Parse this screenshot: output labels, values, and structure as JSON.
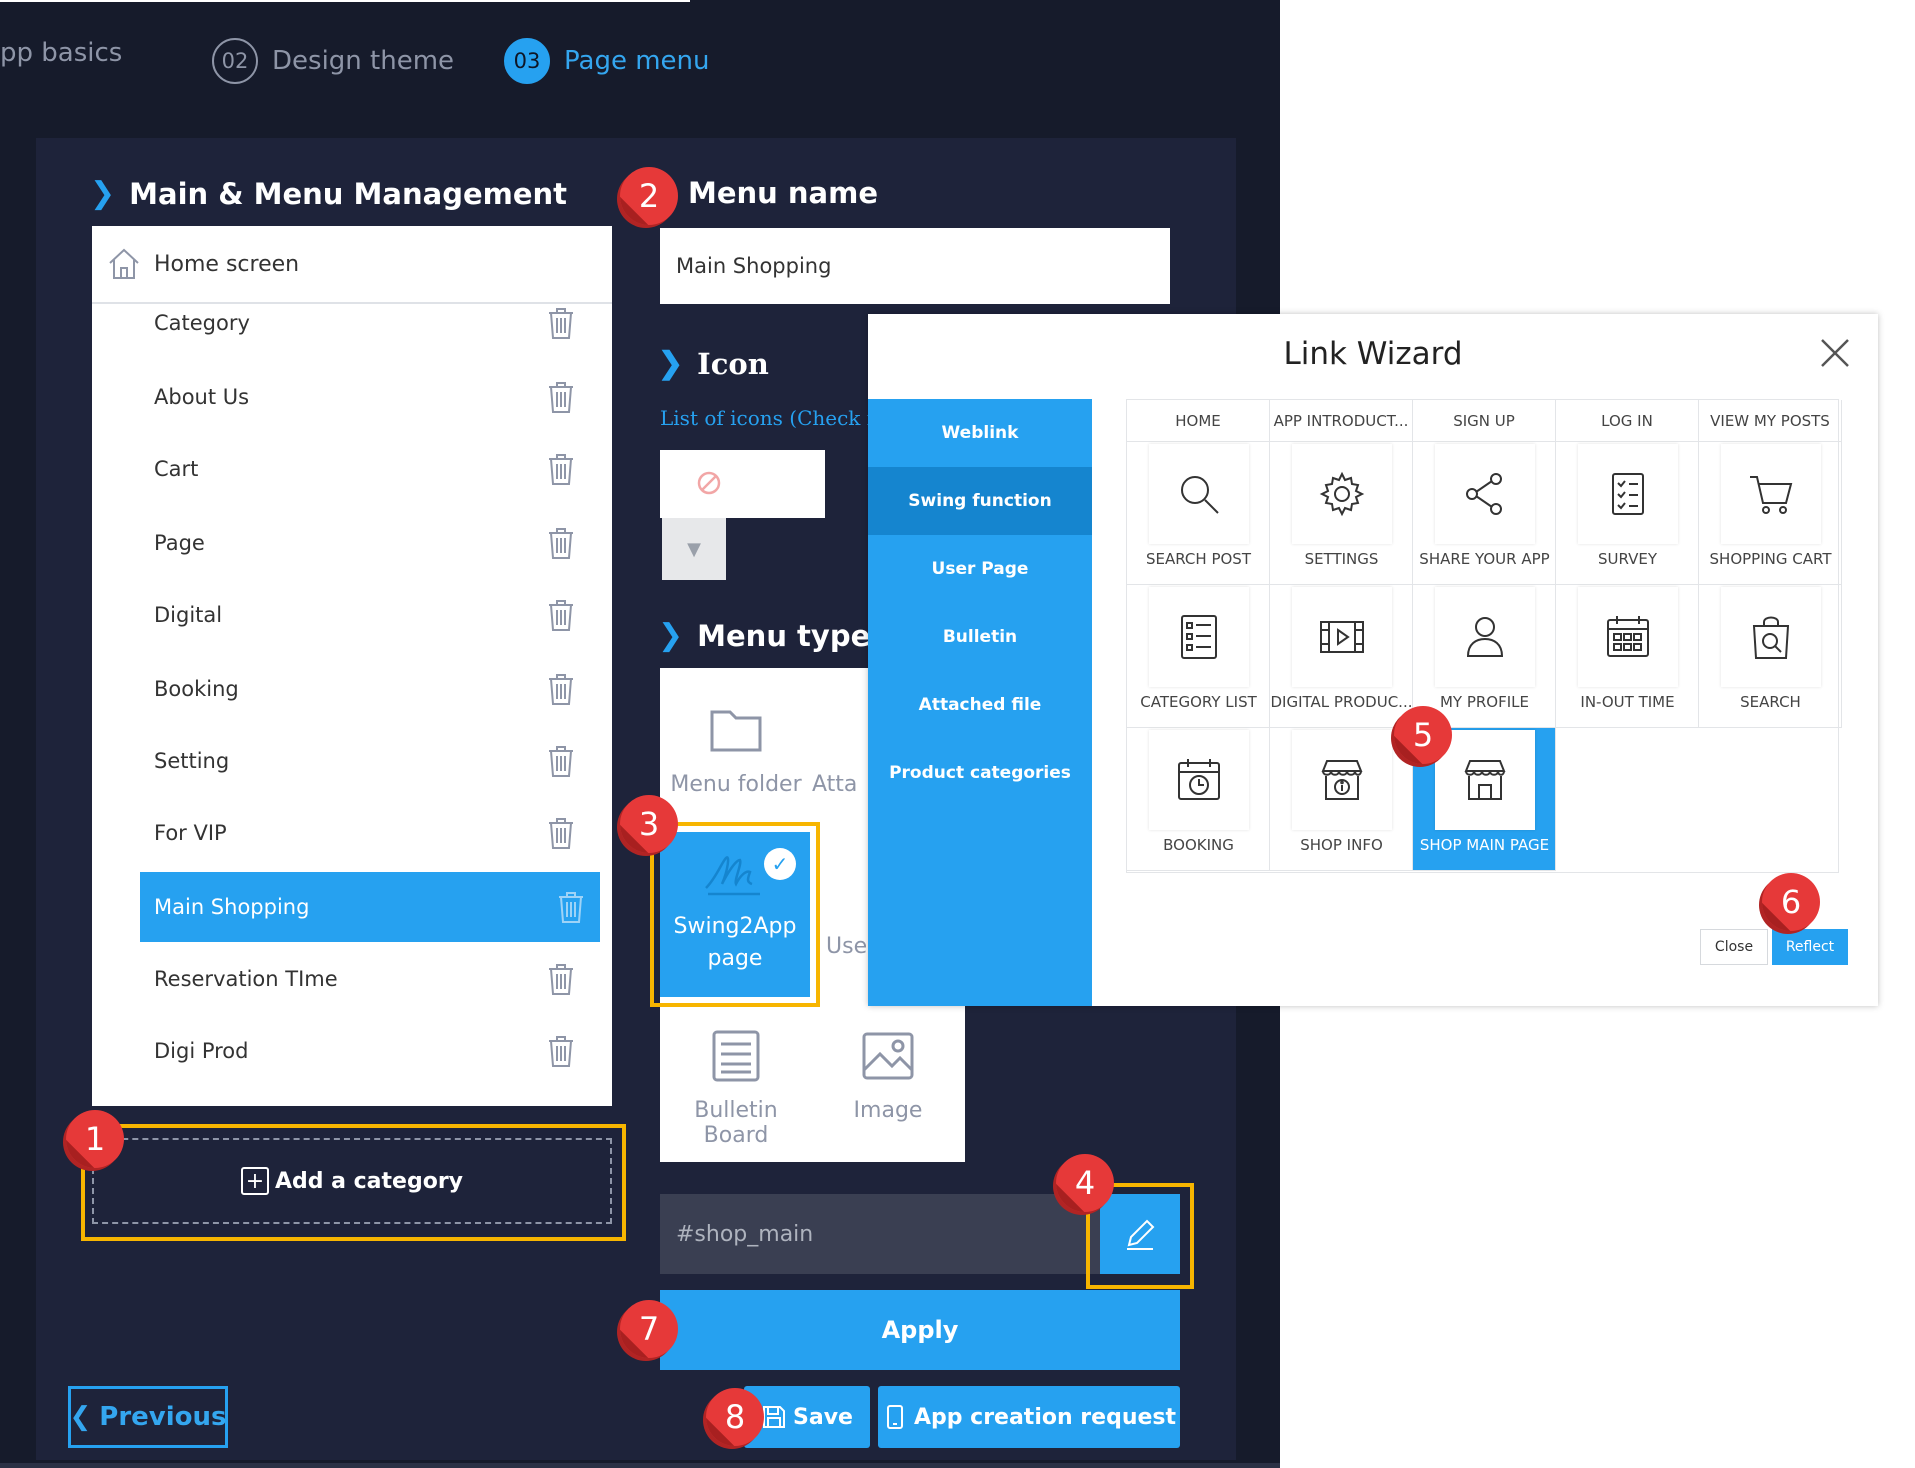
{
  "steps": [
    {
      "num": "",
      "label": "pp basics"
    },
    {
      "num": "02",
      "label": "Design theme"
    },
    {
      "num": "03",
      "label": "Page menu"
    }
  ],
  "main_menu": {
    "title": "Main & Menu Management",
    "home_label": "Home screen",
    "items": [
      "Category",
      "About Us",
      "Cart",
      "Page",
      "Digital",
      "Booking",
      "Setting",
      "For VIP",
      "Main Shopping",
      "Reservation TIme",
      "Digi Prod"
    ],
    "selected": "Main Shopping",
    "add_label": "Add a category"
  },
  "menu_name": {
    "title": "Menu name",
    "value": "Main Shopping"
  },
  "icon_section": {
    "title": "Icon",
    "hint": "List of icons (Check ic"
  },
  "menu_type": {
    "title": "Menu type",
    "folder_label": "Menu folder",
    "attached_label": "Atta",
    "swing_label_1": "Swing2App",
    "swing_label_2": "page",
    "user_label": "Use",
    "bulletin_label": "Bulletin Board",
    "image_label": "Image"
  },
  "link_value": "#shop_main",
  "buttons": {
    "apply": "Apply",
    "previous": "Previous",
    "save": "Save",
    "app_request": "App creation request"
  },
  "wizard": {
    "title": "Link Wizard",
    "side_items": [
      "Weblink",
      "Swing function",
      "User Page",
      "Bulletin",
      "Attached file",
      "Product categories"
    ],
    "active_side": "Swing function",
    "headers": [
      "HOME",
      "APP INTRODUCT...",
      "SIGN UP",
      "LOG IN",
      "VIEW MY POSTS"
    ],
    "functions": [
      {
        "label": "SEARCH POST",
        "icon": "search-icon"
      },
      {
        "label": "SETTINGS",
        "icon": "gear-icon"
      },
      {
        "label": "SHARE YOUR APP",
        "icon": "share-icon"
      },
      {
        "label": "SURVEY",
        "icon": "checklist-icon"
      },
      {
        "label": "SHOPPING CART",
        "icon": "cart-icon"
      },
      {
        "label": "CATEGORY LIST",
        "icon": "list-icon"
      },
      {
        "label": "DIGITAL PRODUC...",
        "icon": "film-icon"
      },
      {
        "label": "MY PROFILE",
        "icon": "person-icon"
      },
      {
        "label": "IN-OUT TIME",
        "icon": "calendar-grid-icon"
      },
      {
        "label": "SEARCH",
        "icon": "shopping-bag-search-icon"
      },
      {
        "label": "BOOKING",
        "icon": "calendar-clock-icon"
      },
      {
        "label": "SHOP INFO",
        "icon": "shop-info-icon"
      },
      {
        "label": "SHOP MAIN PAGE",
        "icon": "storefront-icon"
      }
    ],
    "selected": "SHOP MAIN PAGE",
    "close_label": "Close",
    "reflect_label": "Reflect"
  },
  "badges": [
    "1",
    "2",
    "3",
    "4",
    "5",
    "6",
    "7",
    "8"
  ],
  "colors": {
    "accent": "#26a1f0",
    "highlight": "#f7b500",
    "badge": "#e63939",
    "background": "#161b2b"
  }
}
